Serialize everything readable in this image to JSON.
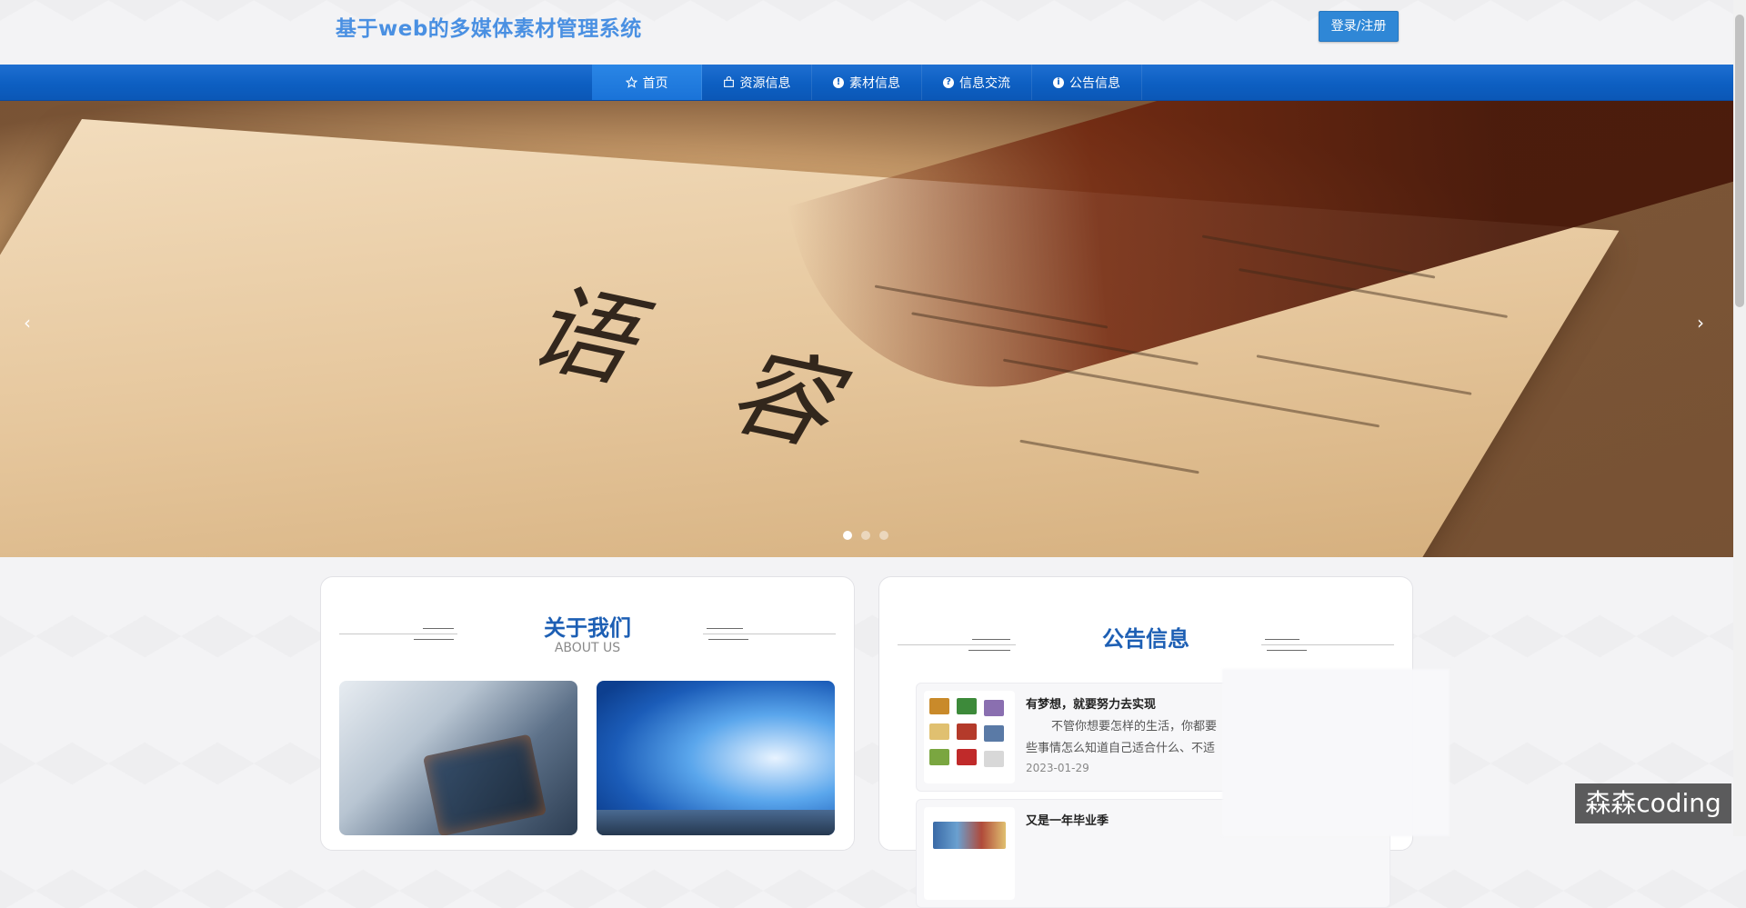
{
  "header": {
    "site_title": "基于web的多媒体素材管理系统",
    "login_label": "登录/注册"
  },
  "nav": {
    "items": [
      {
        "label": "首页",
        "icon": "star-icon",
        "active": true
      },
      {
        "label": "资源信息",
        "icon": "bag-icon"
      },
      {
        "label": "素材信息",
        "icon": "info-circle-icon"
      },
      {
        "label": "信息交流",
        "icon": "question-circle-icon"
      },
      {
        "label": "公告信息",
        "icon": "info-circle-icon"
      }
    ]
  },
  "banner": {
    "prev_glyph": "‹",
    "next_glyph": "›",
    "slide_count": 3,
    "active_slide": 1
  },
  "about": {
    "title": "关于我们",
    "subtitle": "ABOUT US"
  },
  "notice": {
    "title": "公告信息",
    "items": [
      {
        "title": "有梦想，就要努力去实现",
        "body_line1": "不管你想要怎样的生活，你都要",
        "body_line2": "些事情怎么知道自己适合什么、不适",
        "date": "2023-01-29"
      },
      {
        "title": "又是一年毕业季"
      }
    ]
  },
  "watermark": "森森coding",
  "colors": {
    "nav_blue": "#0d5fc2",
    "title_blue": "#4a90e2",
    "heading_blue": "#1d5fb4"
  }
}
